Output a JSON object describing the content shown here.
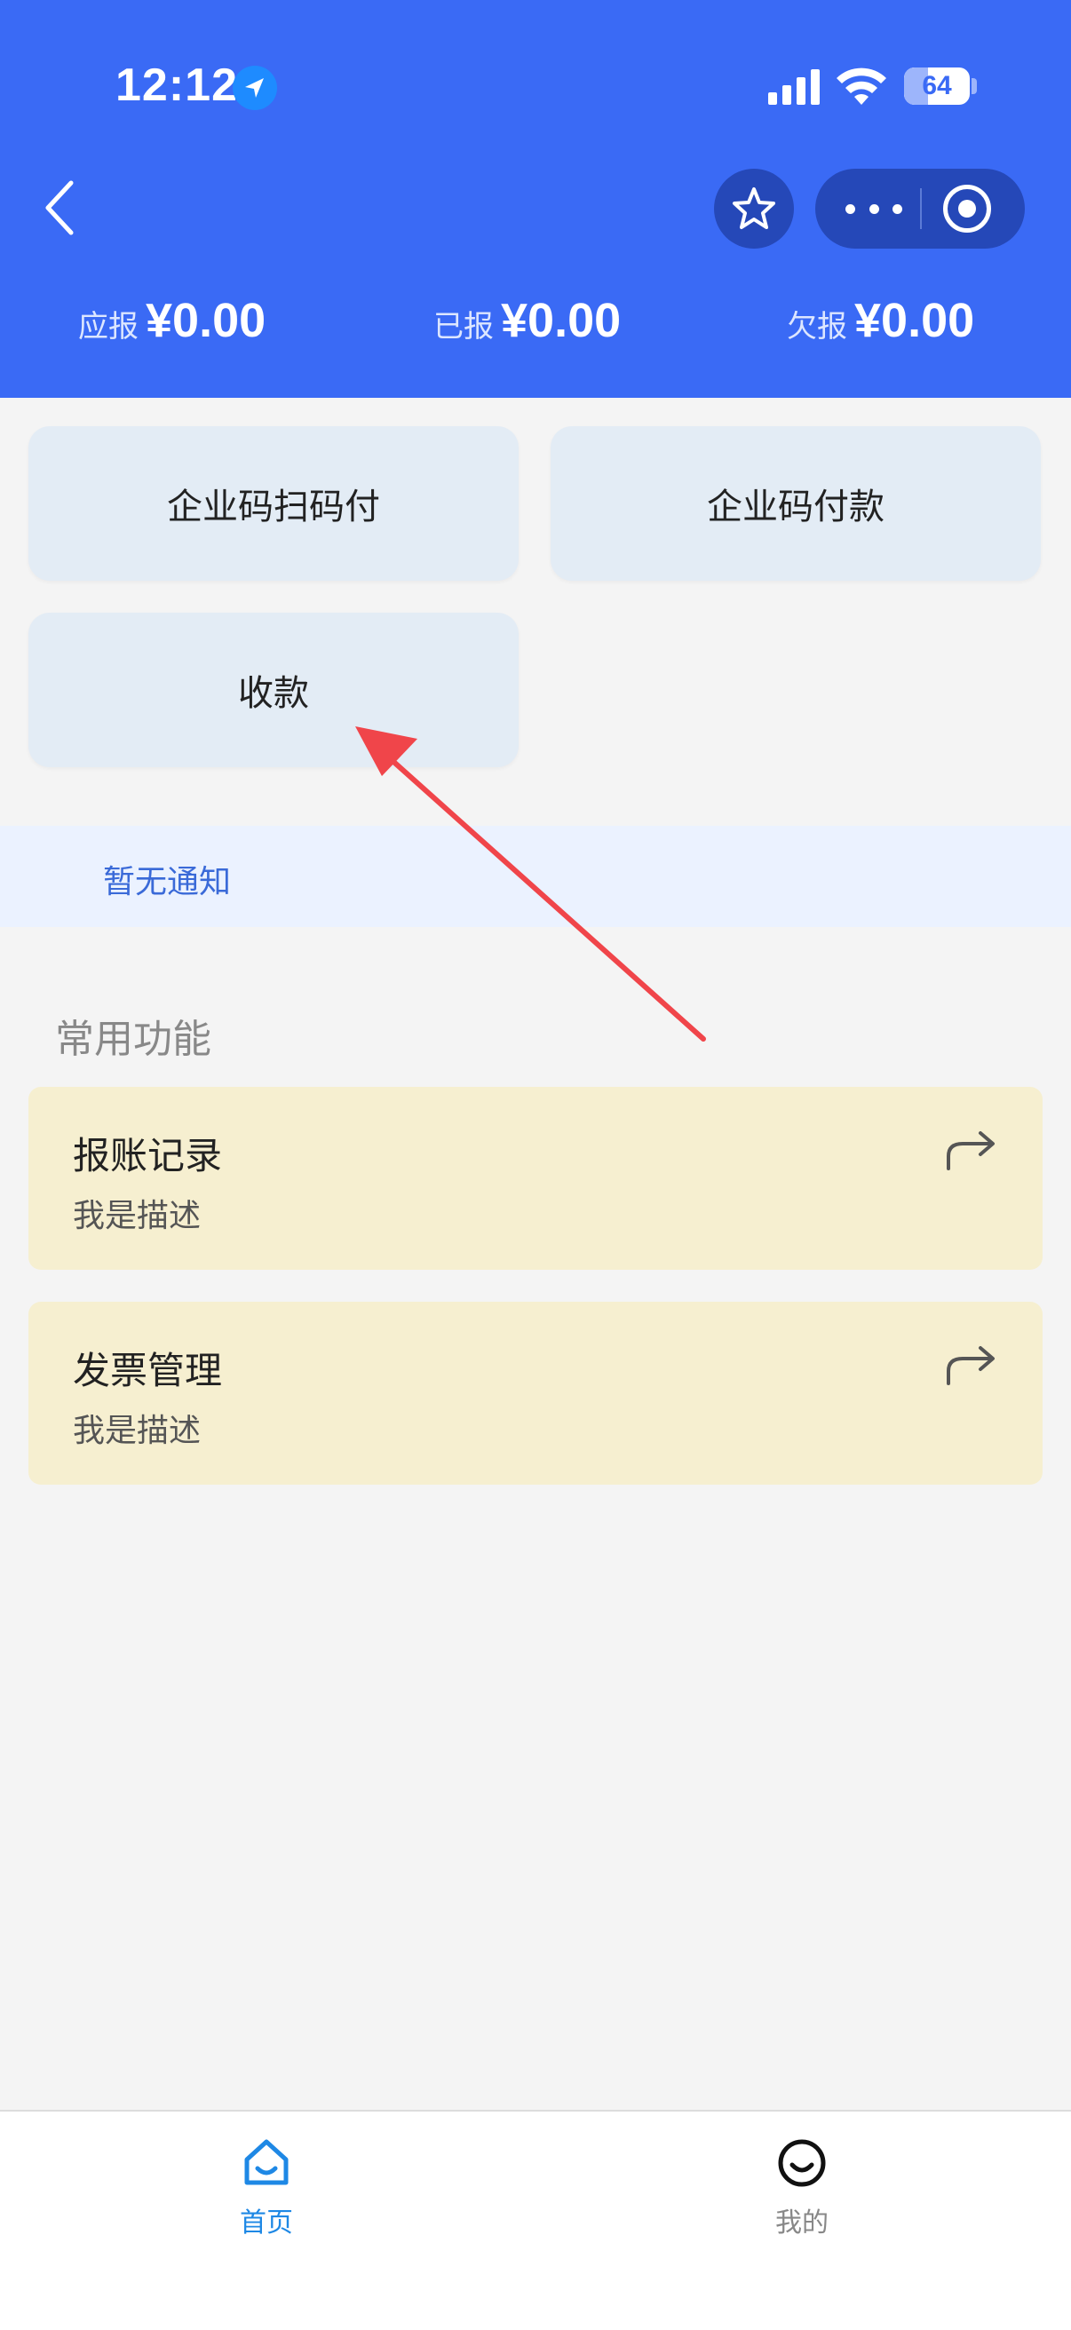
{
  "status_bar": {
    "time": "12:12",
    "battery": "64",
    "battery_fraction": 0.64
  },
  "summary": [
    {
      "label": "应报",
      "amount": "¥0.00"
    },
    {
      "label": "已报",
      "amount": "¥0.00"
    },
    {
      "label": "欠报",
      "amount": "¥0.00"
    }
  ],
  "actions": [
    {
      "label": "企业码扫码付"
    },
    {
      "label": "企业码付款"
    },
    {
      "label": "收款"
    }
  ],
  "notice": {
    "text": "暂无通知"
  },
  "section": {
    "title": "常用功能"
  },
  "functions": [
    {
      "title": "报账记录",
      "desc": "我是描述"
    },
    {
      "title": "发票管理",
      "desc": "我是描述"
    }
  ],
  "tabs": [
    {
      "label": "首页",
      "active": true
    },
    {
      "label": "我的",
      "active": false
    }
  ],
  "colors": {
    "header": "#3a6af5",
    "card": "#e3ecf5",
    "function_card": "#f6efd0",
    "tab_active": "#1e88e5",
    "tab_inactive": "#888888",
    "annotation_arrow": "#f0454a"
  }
}
